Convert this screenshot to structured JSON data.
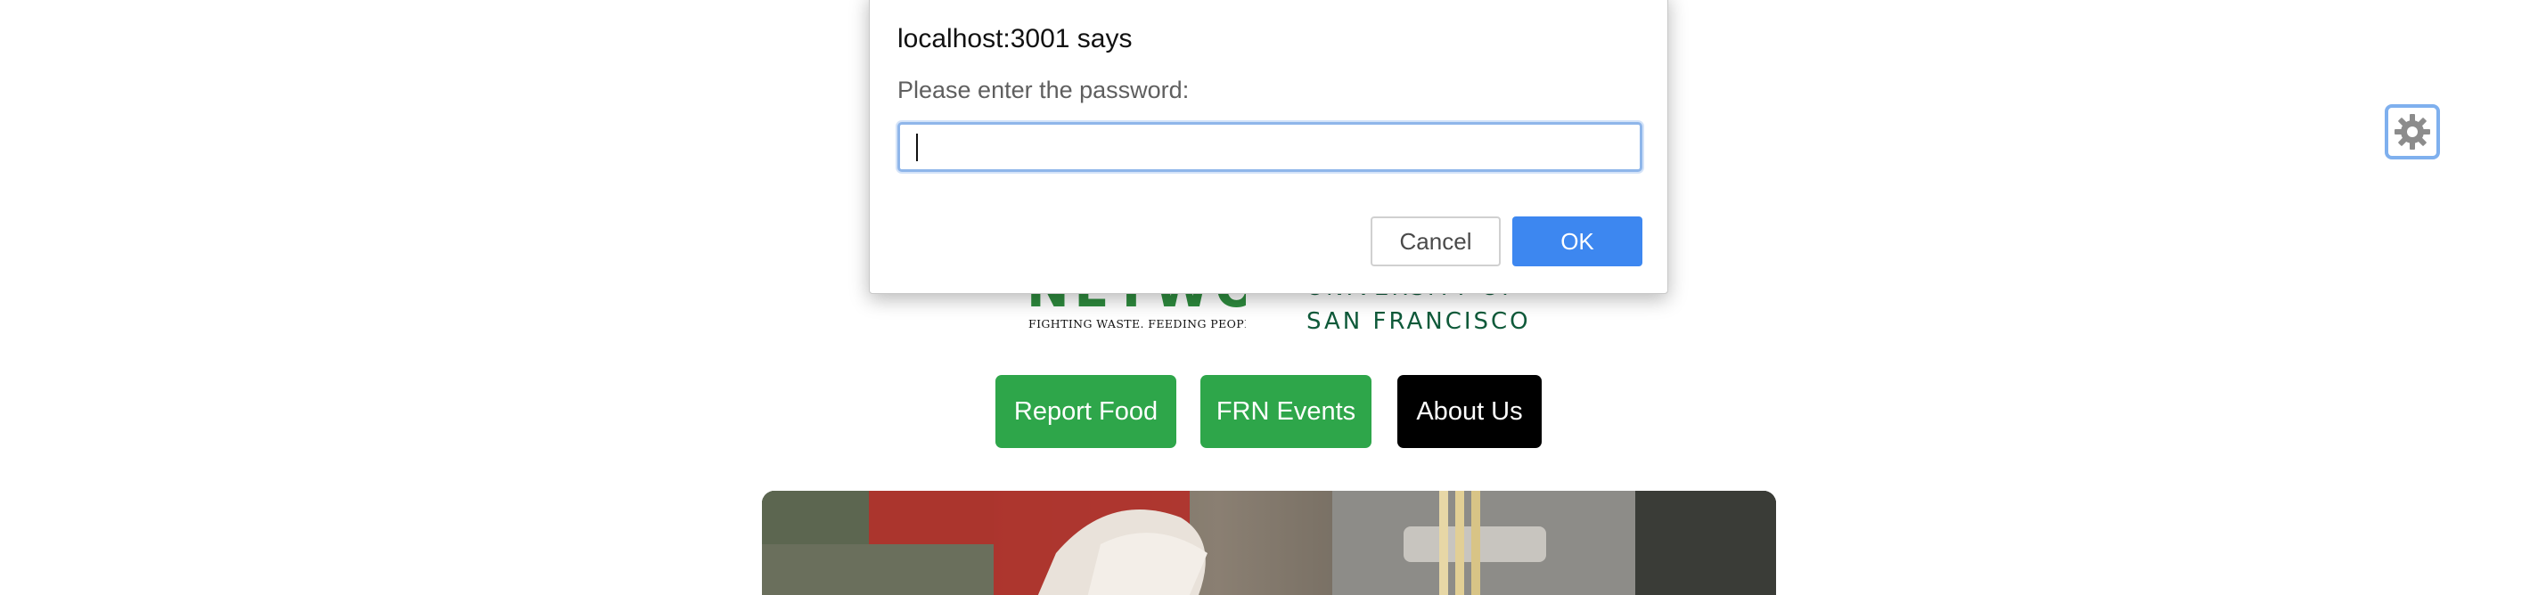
{
  "logos": {
    "frn": {
      "wordmark": "NETWORK",
      "tagline": "FIGHTING WASTE. FEEDING PEOPLE."
    },
    "usf": {
      "line1": "UNIVERSITY OF",
      "line2": "SAN FRANCISCO"
    }
  },
  "nav": {
    "report_food": "Report Food",
    "frn_events": "FRN Events",
    "about_us": "About Us"
  },
  "settings": {
    "icon": "gear-icon"
  },
  "dialog": {
    "title": "localhost:3001 says",
    "message": "Please enter the password:",
    "input_value": "",
    "cancel_label": "Cancel",
    "ok_label": "OK"
  },
  "colors": {
    "nav_green": "#2ea64a",
    "nav_black": "#000000",
    "frn_green": "#2e8b3e",
    "usf_green": "#0f5a3a",
    "ok_blue": "#3d87f0",
    "focus_ring": "#8fb6ea"
  }
}
